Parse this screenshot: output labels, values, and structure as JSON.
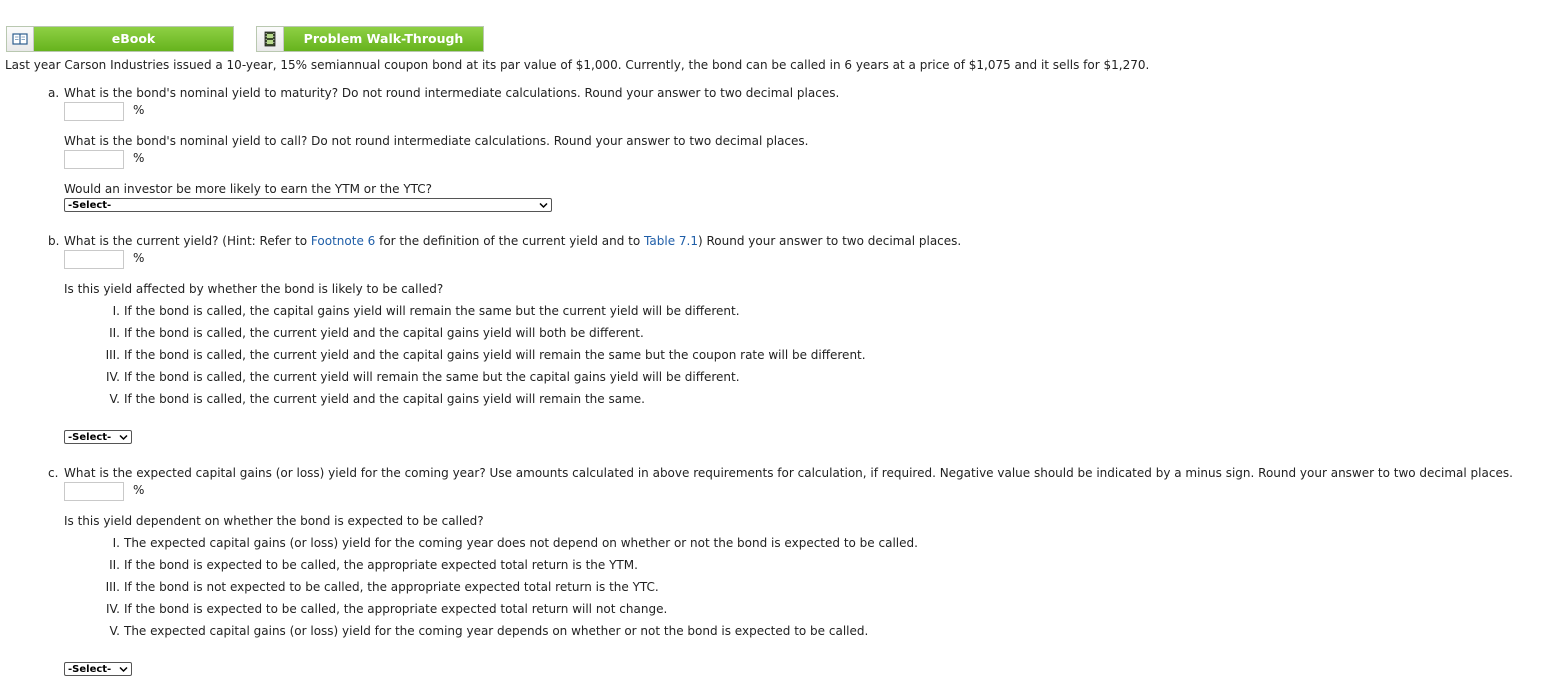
{
  "toolbar": {
    "ebook_label": "eBook",
    "walkthrough_label": "Problem Walk-Through"
  },
  "intro": "Last year Carson Industries issued a 10-year, 15% semiannual coupon bond at its par value of $1,000. Currently, the bond can be called in 6 years at a price of $1,075 and it sells for $1,270.",
  "part_a": {
    "letter": "a.",
    "q1": "What is the bond's nominal yield to maturity? Do not round intermediate calculations. Round your answer to two decimal places.",
    "q1_unit": "%",
    "q1_value": "",
    "q2": "What is the bond's nominal yield to call? Do not round intermediate calculations. Round your answer to two decimal places.",
    "q2_unit": "%",
    "q2_value": "",
    "q3": "Would an investor be more likely to earn the YTM or the YTC?",
    "q3_select": "-Select-"
  },
  "part_b": {
    "letter": "b.",
    "q_before_link1": "What is the current yield? (Hint: Refer to ",
    "link1": "Footnote 6",
    "q_between": " for the definition of the current yield and to ",
    "link2": "Table 7.1",
    "q_after": ") Round your answer to two decimal places.",
    "unit": "%",
    "value": "",
    "q2": "Is this yield affected by whether the bond is likely to be called?",
    "options": [
      {
        "num": "I.",
        "text": "If the bond is called, the capital gains yield will remain the same but the current yield will be different."
      },
      {
        "num": "II.",
        "text": "If the bond is called, the current yield and the capital gains yield will both be different."
      },
      {
        "num": "III.",
        "text": "If the bond is called, the current yield and the capital gains yield will remain the same but the coupon rate will be different."
      },
      {
        "num": "IV.",
        "text": "If the bond is called, the current yield will remain the same but the capital gains yield will be different."
      },
      {
        "num": "V.",
        "text": "If the bond is called, the current yield and the capital gains yield will remain the same."
      }
    ],
    "select": "-Select-"
  },
  "part_c": {
    "letter": "c.",
    "q1": "What is the expected capital gains (or loss) yield for the coming year? Use amounts calculated in above requirements for calculation, if required. Negative value should be indicated by a minus sign. Round your answer to two decimal places.",
    "unit": "%",
    "value": "",
    "q2": "Is this yield dependent on whether the bond is expected to be called?",
    "options": [
      {
        "num": "I.",
        "text": "The expected capital gains (or loss) yield for the coming year does not depend on whether or not the bond is expected to be called."
      },
      {
        "num": "II.",
        "text": "If the bond is expected to be called, the appropriate expected total return is the YTM."
      },
      {
        "num": "III.",
        "text": "If the bond is not expected to be called, the appropriate expected total return is the YTC."
      },
      {
        "num": "IV.",
        "text": "If the bond is expected to be called, the appropriate expected total return will not change."
      },
      {
        "num": "V.",
        "text": "The expected capital gains (or loss) yield for the coming year depends on whether or not the bond is expected to be called."
      }
    ],
    "select": "-Select-"
  }
}
